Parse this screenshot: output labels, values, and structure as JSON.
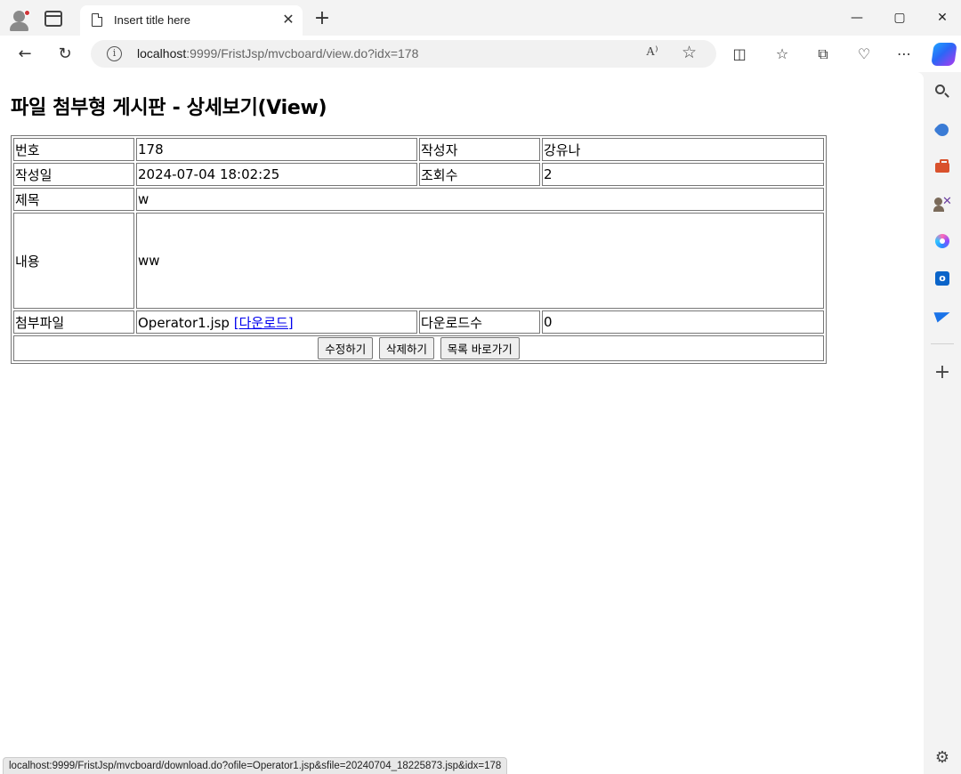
{
  "browser": {
    "tab_title": "Insert title here",
    "tab_close": "✕",
    "new_tab": "+",
    "window_minimize": "—",
    "window_maximize": "▢",
    "window_close": "✕",
    "url_host": "localhost",
    "url_rest": ":9999/FristJsp/mvcboard/view.do?idx=178",
    "read_aloud": "A⁾",
    "status_url": "localhost:9999/FristJsp/mvcboard/download.do?ofile=Operator1.jsp&sfile=20240704_18225873.jsp&idx=178"
  },
  "page": {
    "heading": "파일 첨부형 게시판 - 상세보기(View)"
  },
  "post": {
    "labels": {
      "number": "번호",
      "author": "작성자",
      "date": "작성일",
      "views": "조회수",
      "title": "제목",
      "content": "내용",
      "attachment": "첨부파일",
      "download_count": "다운로드수"
    },
    "values": {
      "number": "178",
      "author": "강유나",
      "date": "2024-07-04 18:02:25",
      "views": "2",
      "title": "w",
      "content": "ww",
      "attachment_name": "Operator1.jsp",
      "download_link": "[다운로드]",
      "download_count": "0"
    }
  },
  "buttons": {
    "edit": "수정하기",
    "delete": "삭제하기",
    "list": "목록 바로가기"
  }
}
